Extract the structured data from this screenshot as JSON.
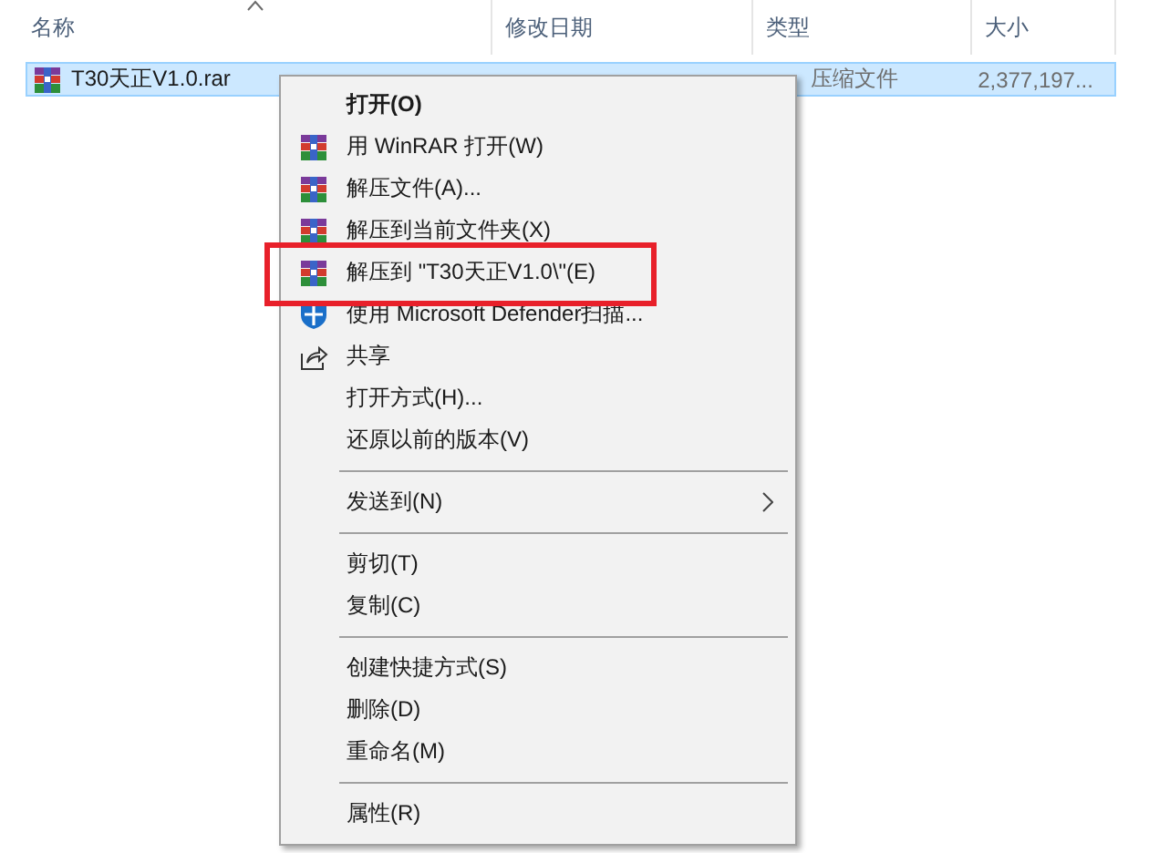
{
  "columns": [
    {
      "label": "名称",
      "sorted": true
    },
    {
      "label": "修改日期",
      "sorted": false
    },
    {
      "label": "类型",
      "sorted": false
    },
    {
      "label": "大小",
      "sorted": false
    }
  ],
  "file": {
    "name": "T30天正V1.0.rar",
    "type": "压缩文件",
    "size": "2,377,197...",
    "selected": true
  },
  "menu": [
    {
      "kind": "default",
      "label": "打开(O)"
    },
    {
      "kind": "winrar",
      "label": "用 WinRAR 打开(W)"
    },
    {
      "kind": "winrar",
      "label": "解压文件(A)..."
    },
    {
      "kind": "winrar",
      "label": "解压到当前文件夹(X)"
    },
    {
      "kind": "winrar",
      "label": "解压到 \"T30天正V1.0\\\"(E)"
    },
    {
      "kind": "defender",
      "label": "使用 Microsoft Defender扫描..."
    },
    {
      "kind": "share",
      "label": "共享"
    },
    {
      "kind": "plain",
      "label": "打开方式(H)..."
    },
    {
      "kind": "plain",
      "label": "还原以前的版本(V)"
    },
    {
      "kind": "separator"
    },
    {
      "kind": "submenu",
      "label": "发送到(N)"
    },
    {
      "kind": "separator"
    },
    {
      "kind": "plain",
      "label": "剪切(T)"
    },
    {
      "kind": "plain",
      "label": "复制(C)"
    },
    {
      "kind": "separator"
    },
    {
      "kind": "plain",
      "label": "创建快捷方式(S)"
    },
    {
      "kind": "plain",
      "label": "删除(D)"
    },
    {
      "kind": "plain",
      "label": "重命名(M)"
    },
    {
      "kind": "separator"
    },
    {
      "kind": "plain",
      "label": "属性(R)"
    }
  ]
}
